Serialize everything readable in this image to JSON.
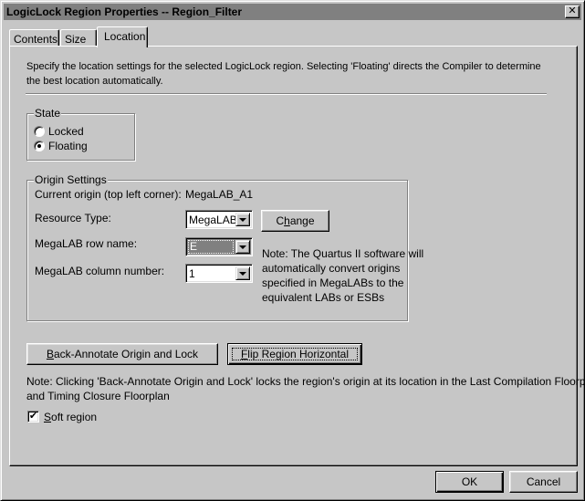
{
  "window": {
    "title": "LogicLock Region Properties -- Region_Filter",
    "close_glyph": "✕"
  },
  "tabs": [
    {
      "label": "Contents",
      "active": false
    },
    {
      "label": "Size",
      "active": false
    },
    {
      "label": "Location",
      "active": true
    }
  ],
  "location": {
    "description_line1": "Specify the location settings for the selected LogicLock region.  Selecting 'Floating' directs the Compiler to determine",
    "description_line2": "the best location automatically.",
    "state": {
      "legend": "State",
      "options": [
        {
          "label": "Locked",
          "selected": false
        },
        {
          "label": "Floating",
          "selected": true
        }
      ]
    },
    "origin_settings": {
      "legend": "Origin Settings",
      "current_origin_label": "Current origin (top left corner):",
      "current_origin_value": "MegaLAB_A1",
      "resource_type_label": "Resource Type:",
      "resource_type_value": "MegaLAB",
      "change_button": {
        "pre": "C",
        "accel": "h",
        "post": "ange"
      },
      "row_name_label": "MegaLAB row name:",
      "row_name_value": "E",
      "column_number_label": "MegaLAB column number:",
      "column_number_value": "1",
      "note_lines": [
        "Note: The Quartus II software will",
        "automatically convert origins",
        "specified in MegaLABs to the",
        "equivalent LABs or ESBs"
      ]
    },
    "back_annotate_button": {
      "accel": "B",
      "post": "ack-Annotate Origin and Lock"
    },
    "flip_button": {
      "accel": "F",
      "post": "lip Region Horizontal"
    },
    "note_line1": "Note: Clicking 'Back-Annotate Origin and Lock' locks the region's origin at its location in the Last Compilation Floorplan",
    "note_line2": "and Timing Closure Floorplan",
    "soft_region": {
      "accel": "S",
      "post": "oft region",
      "checked": true,
      "check_glyph": "✔"
    }
  },
  "footer": {
    "ok_label": "OK",
    "cancel_label": "Cancel"
  }
}
